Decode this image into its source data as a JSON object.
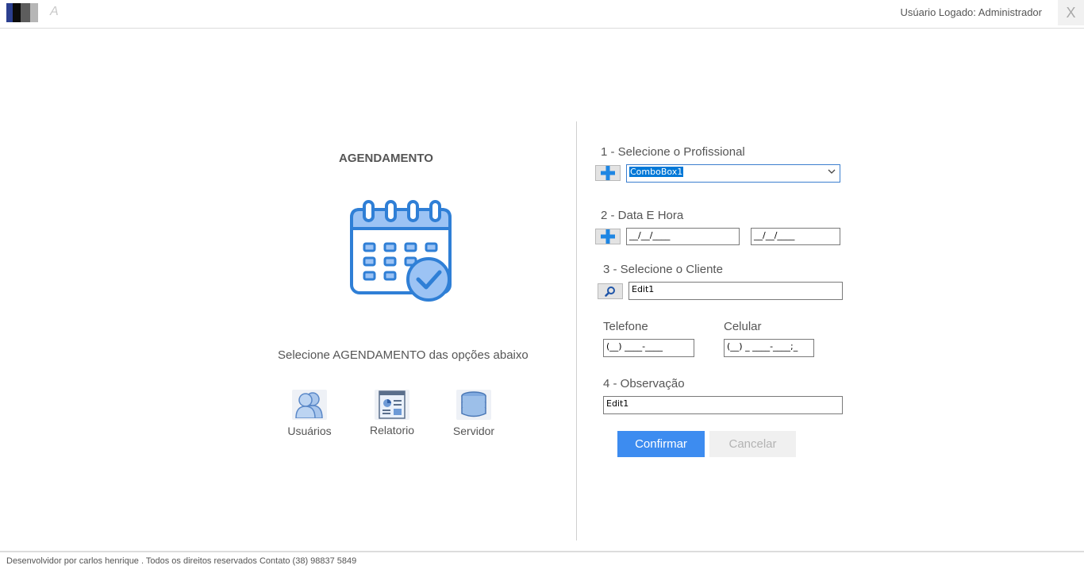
{
  "header": {
    "app_letter": "A",
    "user_logged": "Usúario Logado: Administrador",
    "close_label": "X"
  },
  "left": {
    "title": "AGENDAMENTO",
    "subtitle": "Selecione AGENDAMENTO das opções abaixo",
    "options": [
      {
        "label": "Usuários",
        "icon": "users-icon"
      },
      {
        "label": "Relatorio",
        "icon": "report-icon"
      },
      {
        "label": "Servidor",
        "icon": "database-icon"
      }
    ]
  },
  "form": {
    "step1_label": "1 - Selecione o Profissional",
    "combo_value": "ComboBox1",
    "step2_label": "2 - Data E Hora",
    "date_value": "__/__/____",
    "time_value": "__/__/____",
    "step3_label": "3 - Selecione o Cliente",
    "client_value": "Edit1",
    "telefone_label": "Telefone",
    "telefone_value": "(__) ____-____",
    "celular_label": "Celular",
    "celular_value": "(__) _ ____-____;_",
    "step4_label": "4 - Observação",
    "obs_value": "Edit1",
    "confirm_label": "Confirmar",
    "cancel_label": "Cancelar"
  },
  "colors": {
    "accent": "#3d8cf0",
    "icon_blue": "#2f7fd6",
    "icon_light": "#9cc3f4"
  },
  "footer": {
    "text": "Desenvolvidor por carlos henrique . Todos os direitos reservados Contato (38) 98837 5849"
  }
}
